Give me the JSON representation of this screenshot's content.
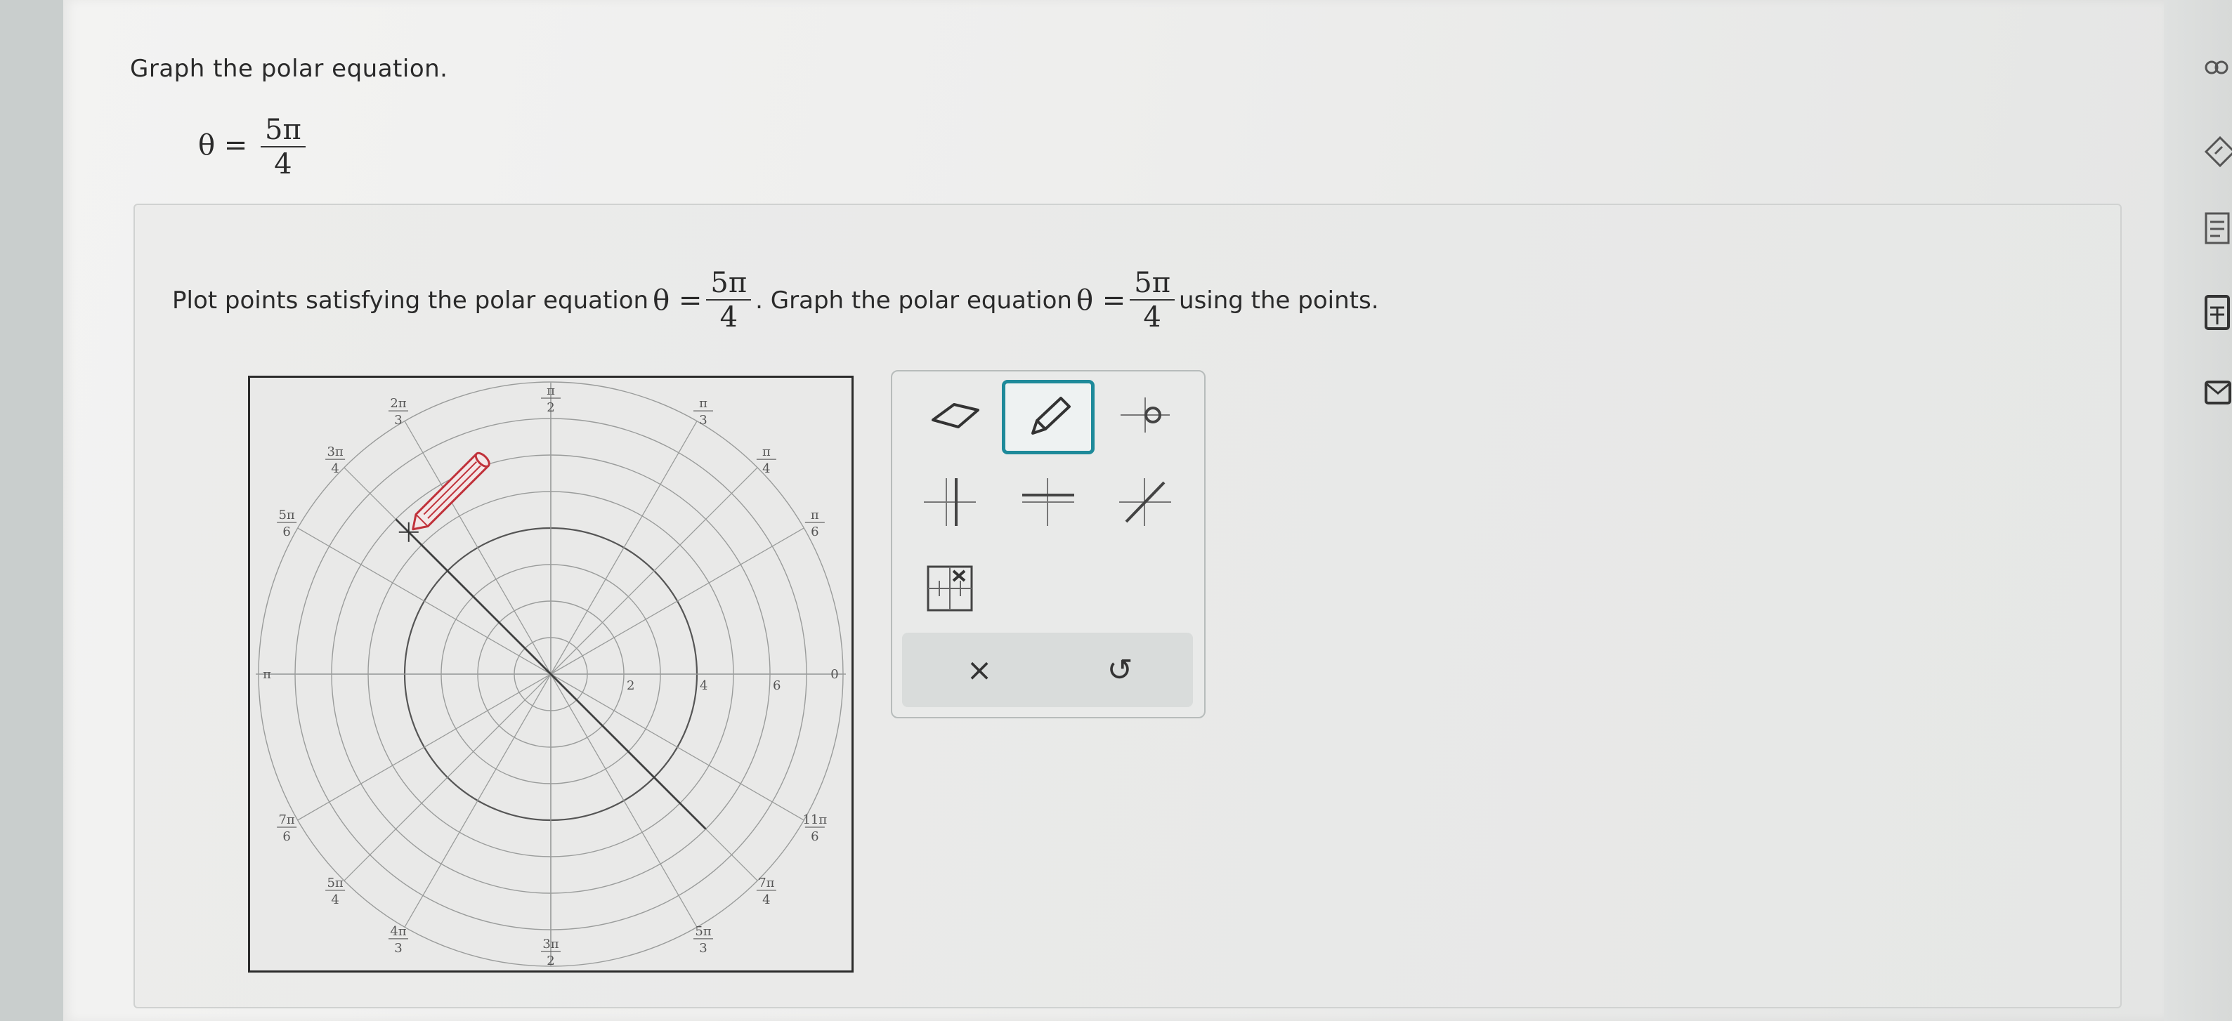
{
  "question": {
    "prompt": "Graph the polar equation.",
    "equation_lhs": "θ =",
    "equation_num": "5π",
    "equation_den": "4"
  },
  "instruction": {
    "part1": "Plot points satisfying the polar equation",
    "theta": "θ =",
    "num": "5π",
    "den": "4",
    "part2": ". Graph the polar equation",
    "part3": "using the points."
  },
  "graph": {
    "grid": "polar",
    "radial_rings": [
      1,
      2,
      3,
      4,
      5,
      6,
      7,
      8
    ],
    "r_labels": [
      "2",
      "4",
      "6"
    ],
    "angle_labels": [
      {
        "num": "π",
        "den": "2",
        "deg": 90
      },
      {
        "num": "π",
        "den": "3",
        "deg": 60
      },
      {
        "num": "π",
        "den": "4",
        "deg": 45
      },
      {
        "num": "π",
        "den": "6",
        "deg": 30
      },
      {
        "num": "0",
        "den": "",
        "deg": 0
      },
      {
        "num": "11π",
        "den": "6",
        "deg": 330
      },
      {
        "num": "7π",
        "den": "4",
        "deg": 315
      },
      {
        "num": "5π",
        "den": "3",
        "deg": 300
      },
      {
        "num": "3π",
        "den": "2",
        "deg": 270
      },
      {
        "num": "4π",
        "den": "3",
        "deg": 240
      },
      {
        "num": "5π",
        "den": "4",
        "deg": 225
      },
      {
        "num": "7π",
        "den": "6",
        "deg": 210
      },
      {
        "num": "π",
        "den": "",
        "deg": 180
      },
      {
        "num": "5π",
        "den": "6",
        "deg": 150
      },
      {
        "num": "3π",
        "den": "4",
        "deg": 135
      },
      {
        "num": "2π",
        "den": "3",
        "deg": 120
      }
    ],
    "plotted_line_deg": 135,
    "highlighted_ring_r": 4,
    "cursor": "pencil"
  },
  "toolbar": {
    "tools": [
      "eraser-tool",
      "pencil-tool",
      "point-tool",
      "vertical-line-tool",
      "horizontal-line-tool",
      "line-tool",
      "grid-tool"
    ],
    "active_tool": "pencil-tool",
    "clear_label": "×",
    "undo_label": "↺"
  },
  "colors": {
    "accent": "#1e8a9a",
    "pencil": "#c0313a",
    "grid": "#9a9c9b",
    "line": "#3f4040"
  }
}
